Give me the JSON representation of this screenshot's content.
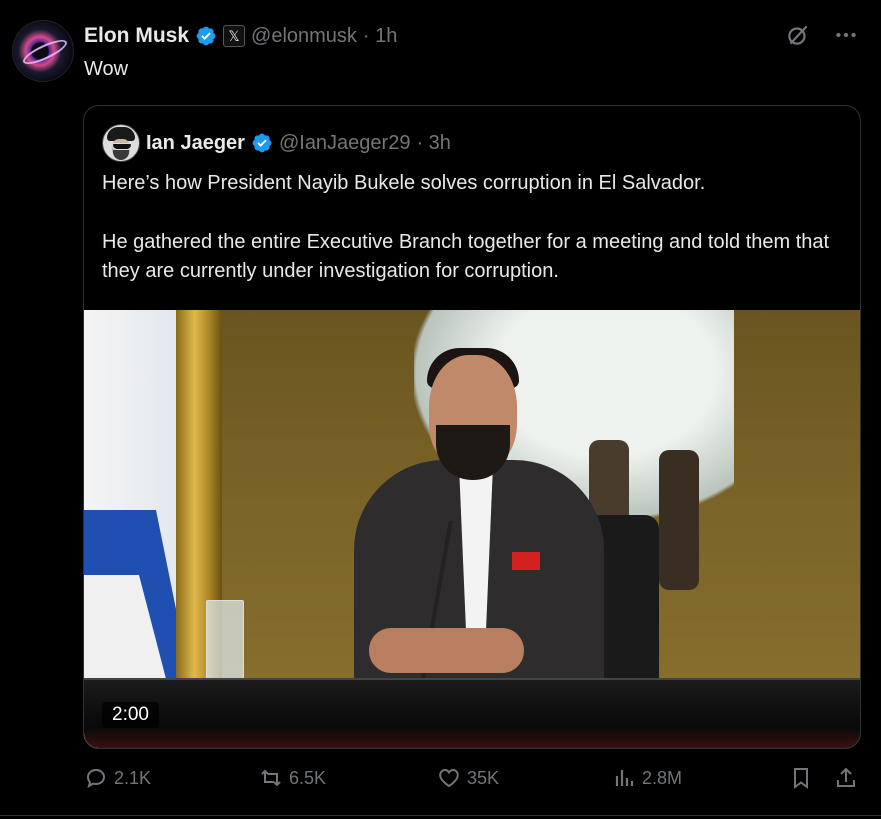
{
  "tweet": {
    "author_name": "Elon Musk",
    "author_handle": "@elonmusk",
    "time": "· 1h",
    "text": "Wow",
    "badge_letter": "𝕏"
  },
  "quote": {
    "author_name": "Ian Jaeger",
    "author_handle": "@IanJaeger29",
    "time": "· 3h",
    "paragraphs": [
      "Here’s how President Nayib Bukele solves corruption in El Salvador.",
      "He gathered the entire Executive Branch together for a meeting and told them that they are currently under investigation for corruption."
    ],
    "video_duration": "2:00"
  },
  "actions": {
    "replies": "2.1K",
    "reposts": "6.5K",
    "likes": "35K",
    "views": "2.8M"
  },
  "colors": {
    "background": "#000000",
    "text": "#e7e9ea",
    "muted": "#71767b",
    "verified": "#1d9bf0",
    "border": "#2f3336"
  },
  "icons": [
    "grok-icon",
    "more-icon",
    "reply-icon",
    "repost-icon",
    "like-icon",
    "views-icon",
    "bookmark-icon",
    "share-icon",
    "verified-icon"
  ]
}
